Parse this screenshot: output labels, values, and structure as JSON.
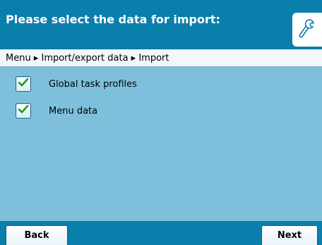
{
  "header": {
    "title": "Please select the data for import:",
    "wrench_icon": "wrench-icon"
  },
  "breadcrumb": {
    "text": "Menu ▸ Import/export data ▸ Import"
  },
  "options": [
    {
      "label": "Global task profiles",
      "checked": true,
      "icon": "check-icon"
    },
    {
      "label": "Menu data",
      "checked": true,
      "icon": "check-icon"
    }
  ],
  "softkeys": {
    "back_label": "Back",
    "next_label": "Next"
  },
  "colors": {
    "header_bg": "#0a7fab",
    "content_bg": "#7ec0dc",
    "breadcrumb_bg": "#f2f7fa",
    "check": "#1a9e1a"
  }
}
